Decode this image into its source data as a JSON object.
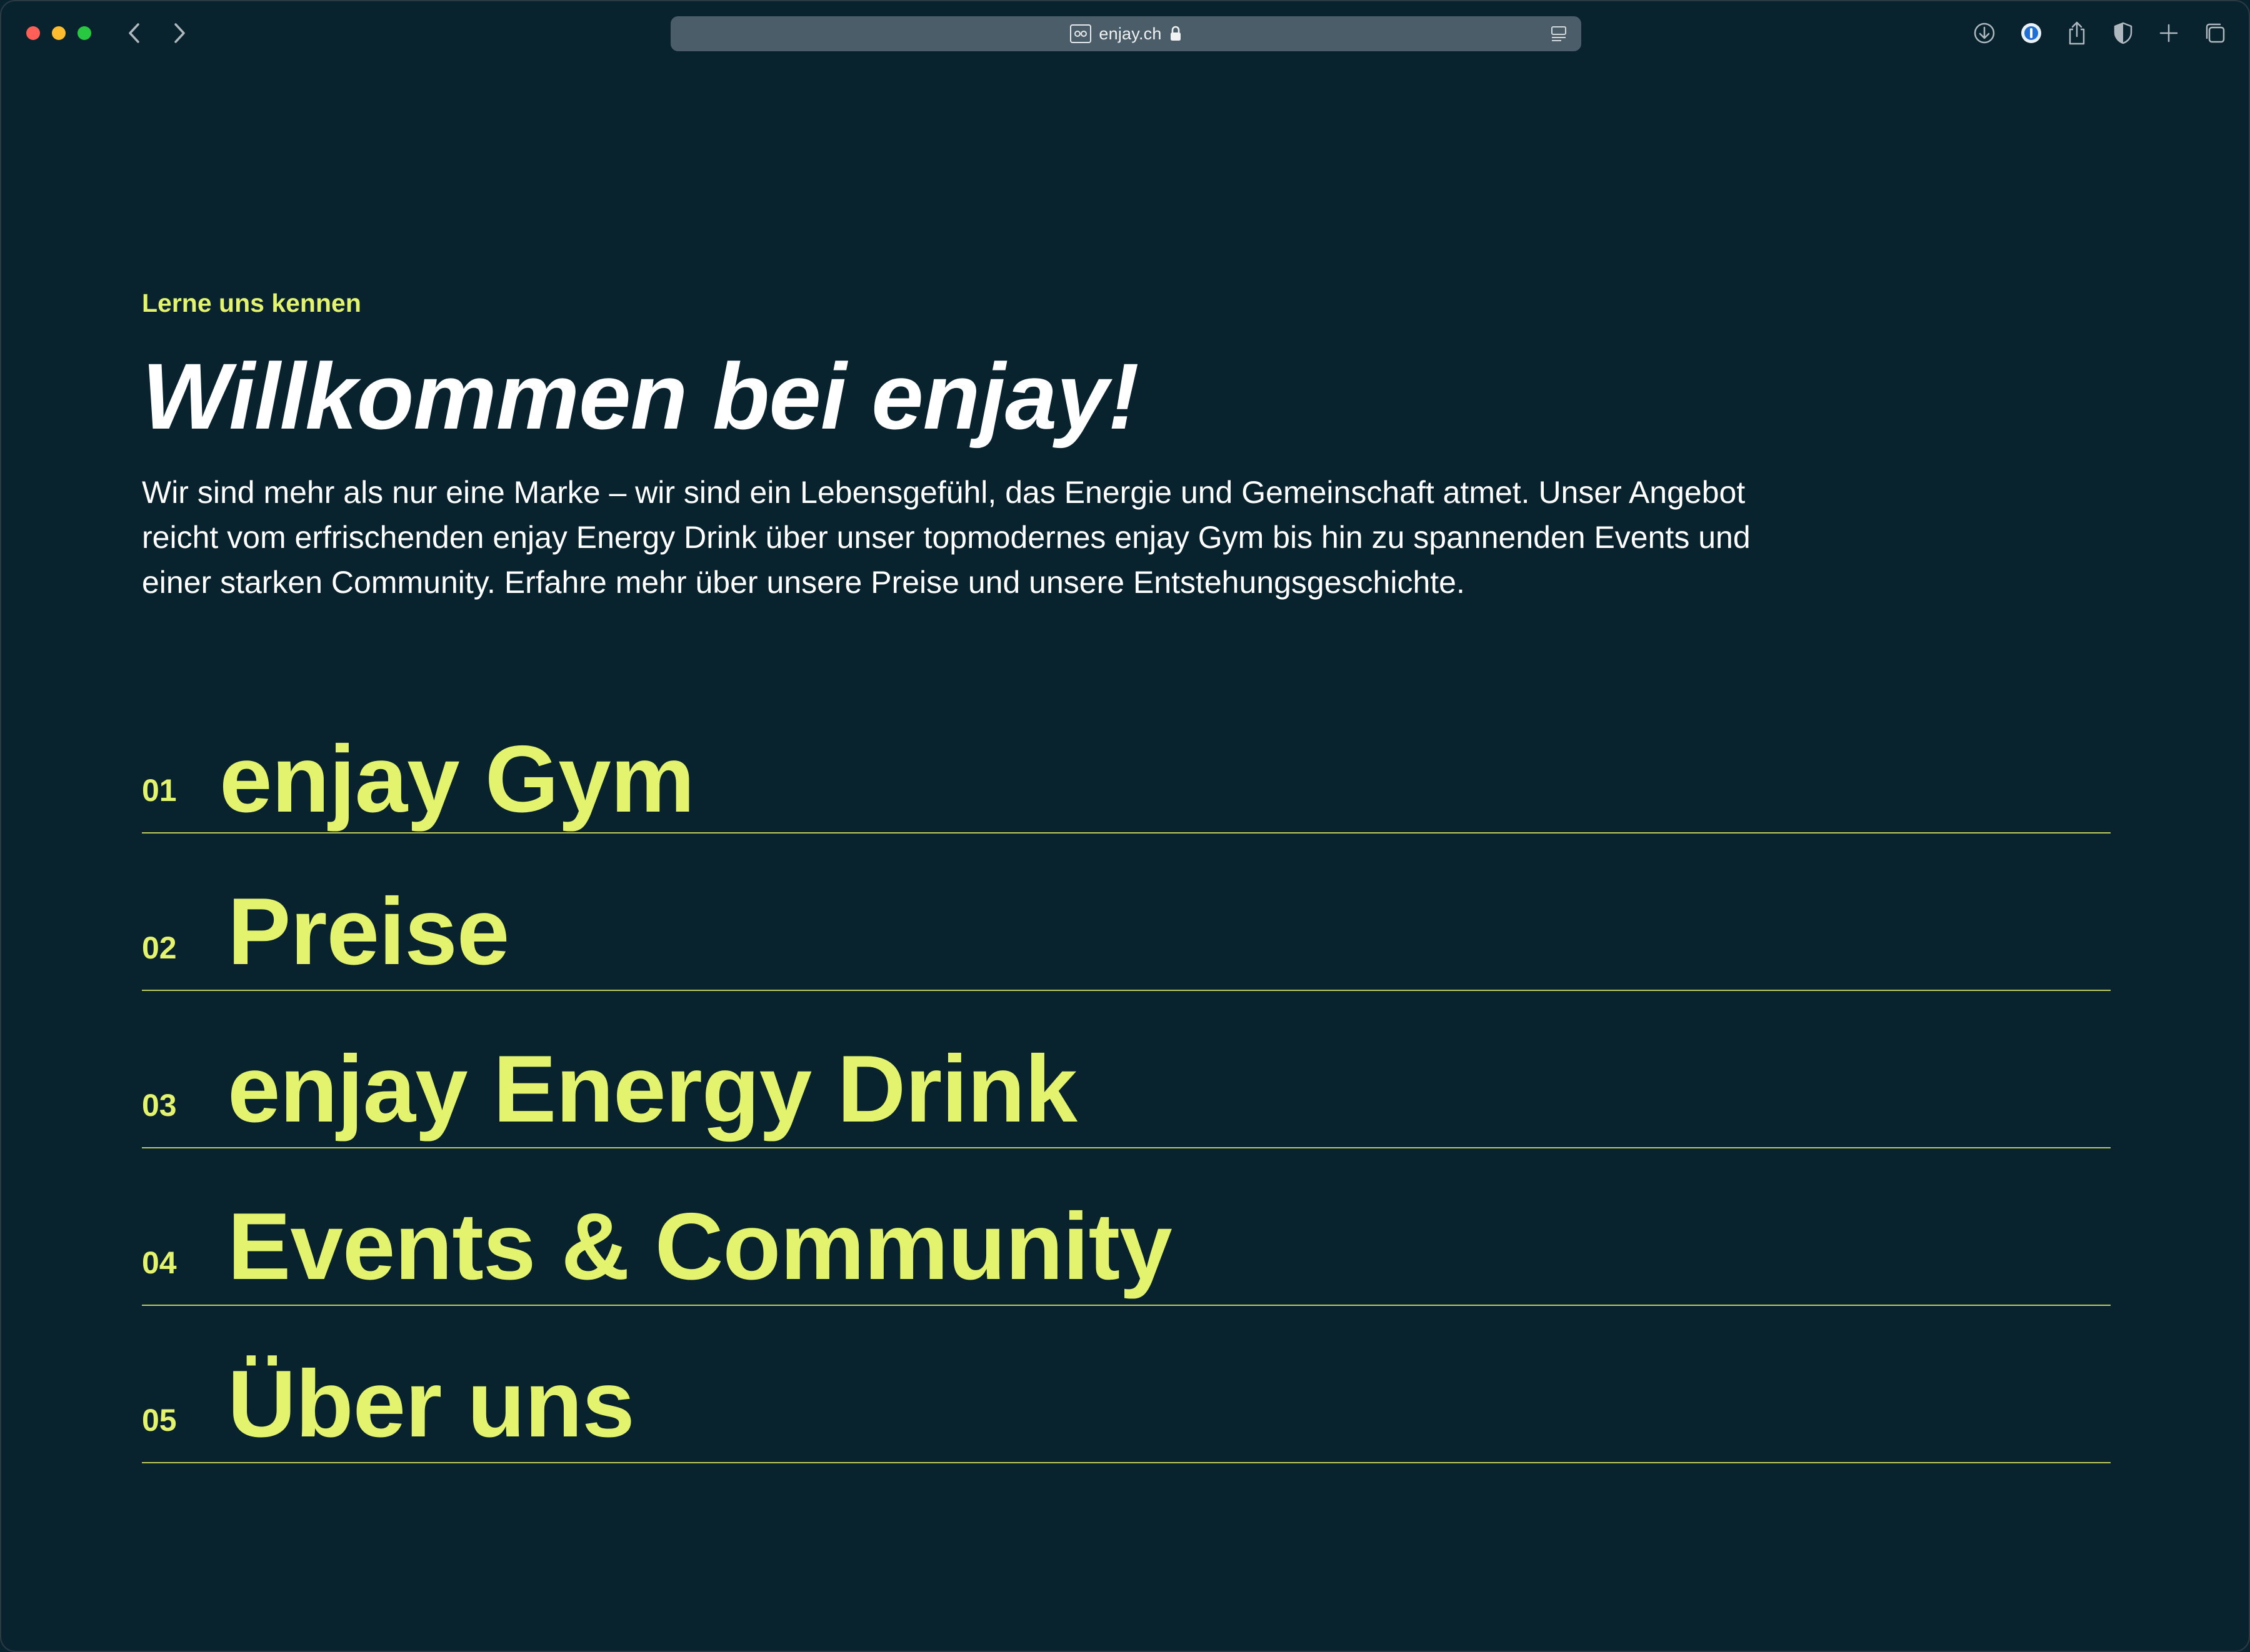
{
  "browser": {
    "url": "enjay.ch",
    "icons": {
      "back": "chevron-left-icon",
      "forward": "chevron-right-icon",
      "site": "site-identity-icon",
      "lock": "lock-icon",
      "reader": "reader-mode-icon",
      "download": "download-icon",
      "password": "password-manager-icon",
      "share": "share-icon",
      "privacy": "shield-icon",
      "new_tab": "plus-icon",
      "tabs": "tab-overview-icon"
    }
  },
  "page": {
    "eyebrow": "Lerne uns kennen",
    "headline": "Willkommen bei enjay!",
    "intro": "Wir sind mehr als nur eine Marke – wir sind ein Lebensgefühl, das Energie und Gemeinschaft atmet. Unser Angebot reicht vom erfrischenden enjay Energy Drink über unser topmodernes enjay Gym bis hin zu spannenden Events und einer starken Community. Erfahre mehr über unsere Preise und unsere Entstehungsgeschichte.",
    "menu": [
      {
        "number": "01",
        "label": "enjay Gym"
      },
      {
        "number": "02",
        "label": "Preise"
      },
      {
        "number": "03",
        "label": "enjay Energy Drink"
      },
      {
        "number": "04",
        "label": "Events & Community"
      },
      {
        "number": "05",
        "label": "Über uns"
      }
    ]
  },
  "colors": {
    "background": "#08222E",
    "accent": "#E4F36D",
    "text": "#FFFFFF",
    "address_bar": "#4A5D68"
  }
}
